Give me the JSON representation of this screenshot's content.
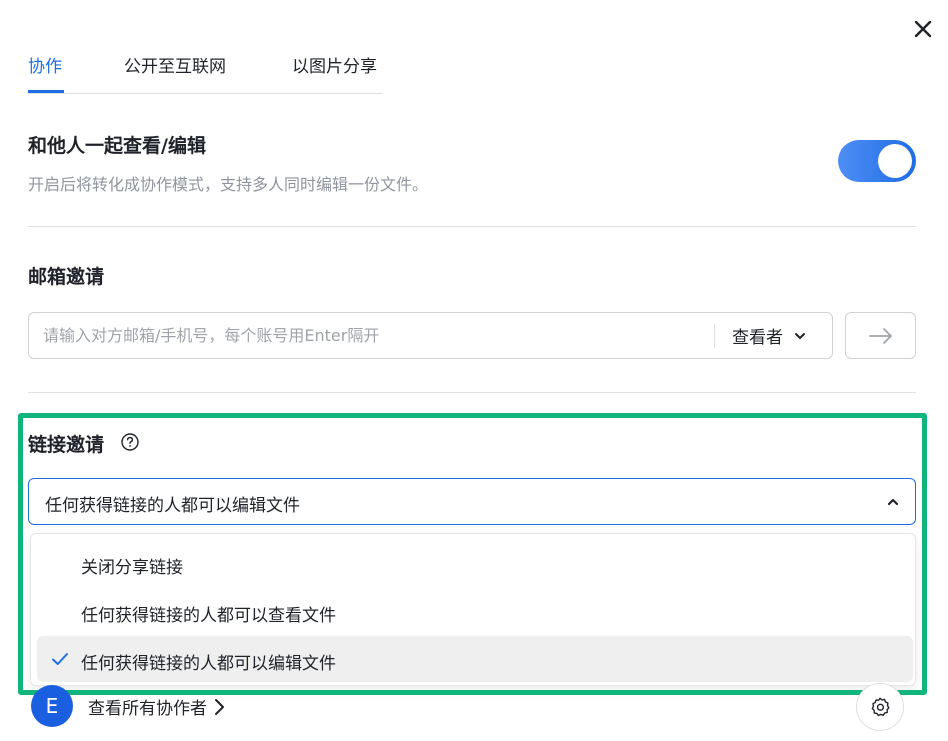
{
  "tabs": [
    {
      "label": "协作",
      "active": true
    },
    {
      "label": "公开至互联网",
      "active": false
    },
    {
      "label": "以图片分享",
      "active": false
    }
  ],
  "collab_section": {
    "title": "和他人一起查看/编辑",
    "description": "开启后将转化成协作模式，支持多人同时编辑一份文件。",
    "toggle_on": true
  },
  "email_section": {
    "title": "邮箱邀请",
    "input_placeholder": "请输入对方邮箱/手机号，每个账号用Enter隔开",
    "input_value": "",
    "role_label": "查看者",
    "send_icon": "arrow-right-icon"
  },
  "link_section": {
    "title": "链接邀请",
    "help_icon": "question-circle-icon",
    "selected_value": "任何获得链接的人都可以编辑文件",
    "options": [
      {
        "label": "关闭分享链接",
        "selected": false
      },
      {
        "label": "任何获得链接的人都可以查看文件",
        "selected": false
      },
      {
        "label": "任何获得链接的人都可以编辑文件",
        "selected": true
      }
    ]
  },
  "footer": {
    "avatar_letter": "E",
    "collaborators_label": "查看所有协作者",
    "settings_icon": "gear-icon"
  },
  "colors": {
    "accent": "#1f6de5",
    "highlight_frame": "#0fb57b",
    "avatar": "#1a5fe0"
  }
}
